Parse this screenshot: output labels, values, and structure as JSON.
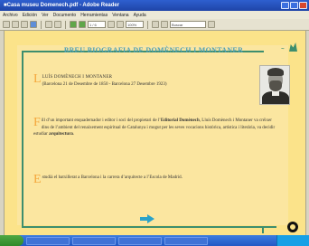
{
  "window": {
    "title": "■Casa museu Domenech.pdf - Adobe Reader"
  },
  "menu": {
    "items": [
      "Archivo",
      "Edición",
      "Ver",
      "Documento",
      "Herramientas",
      "Ventana",
      "Ayuda"
    ]
  },
  "toolbar": {
    "page_field": "1 / 6",
    "zoom_field": "100%",
    "find_placeholder": "Buscar"
  },
  "document": {
    "title": "BREU BIOGRAFIA DE DOMÈNECH I MONTANER",
    "p1": {
      "initial": "L",
      "name": "LUÍS DOMÈNECH I MONTANER",
      "dates": "(Barcelona 21 de Desembre de 1850 - Barcelona 27 Desembre 1923)"
    },
    "p2": {
      "initial": "F",
      "text_a": "ill d’un important enquadernador i editor i soci del propietari de l’",
      "bold_a": "Editorial Domènech",
      "text_b": ", Lluís Domènech i Montaner va créixer dins de l’ambient del renaixement espiritual de Catalunya i mogut per les seves vocacions històrica, artística i literària, va decidir estudiar ",
      "bold_b": "arquitectura",
      "text_c": "."
    },
    "p3": {
      "initial": "E",
      "text": "studià el batxillerat a Barcelona i la carrera d’arquitecte a l’Escola de Madrid."
    }
  },
  "colors": {
    "page": "#fbe38a",
    "frame": "#3d8e6e",
    "title": "#4f9fb5",
    "drop_cap": "#f4a63b",
    "arrow": "#2aa2c9"
  },
  "icons": {
    "logo": "logo-icon",
    "next": "next-arrow-icon",
    "corner": "ring-icon"
  }
}
